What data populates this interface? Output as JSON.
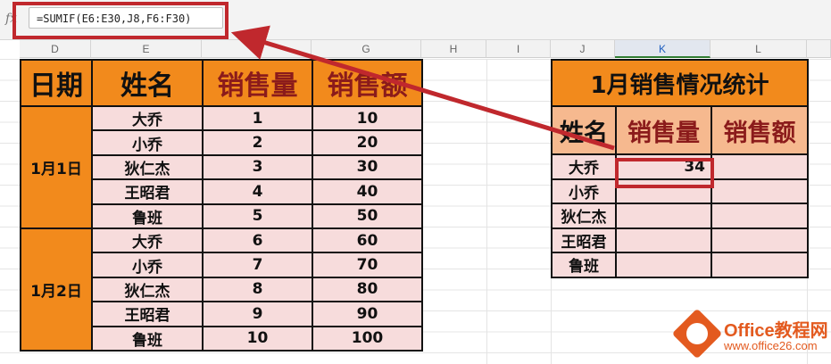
{
  "formula": "=SUMIF(E6:E30,J8,F6:F30)",
  "fx_label": "fx",
  "columns": [
    {
      "label": "D"
    },
    {
      "label": "E"
    },
    {
      "label": "F"
    },
    {
      "label": "G"
    },
    {
      "label": "H"
    },
    {
      "label": "I"
    },
    {
      "label": "J"
    },
    {
      "label": "K"
    },
    {
      "label": "L"
    }
  ],
  "left_table": {
    "headers": [
      "日期",
      "姓名",
      "销售量",
      "销售额"
    ],
    "groups": [
      {
        "date": "1月1日",
        "rows": [
          {
            "name": "大乔",
            "qty": "1",
            "amt": "10"
          },
          {
            "name": "小乔",
            "qty": "2",
            "amt": "20"
          },
          {
            "name": "狄仁杰",
            "qty": "3",
            "amt": "30"
          },
          {
            "name": "王昭君",
            "qty": "4",
            "amt": "40"
          },
          {
            "name": "鲁班",
            "qty": "5",
            "amt": "50"
          }
        ]
      },
      {
        "date": "1月2日",
        "rows": [
          {
            "name": "大乔",
            "qty": "6",
            "amt": "60"
          },
          {
            "name": "小乔",
            "qty": "7",
            "amt": "70"
          },
          {
            "name": "狄仁杰",
            "qty": "8",
            "amt": "80"
          },
          {
            "name": "王昭君",
            "qty": "9",
            "amt": "90"
          },
          {
            "name": "鲁班",
            "qty": "10",
            "amt": "100"
          }
        ]
      }
    ]
  },
  "right_table": {
    "title": "1月销售情况统计",
    "headers": [
      "姓名",
      "销售量",
      "销售额"
    ],
    "rows": [
      {
        "name": "大乔",
        "qty": "34",
        "amt": ""
      },
      {
        "name": "小乔",
        "qty": "",
        "amt": ""
      },
      {
        "name": "狄仁杰",
        "qty": "",
        "amt": ""
      },
      {
        "name": "王昭君",
        "qty": "",
        "amt": ""
      },
      {
        "name": "鲁班",
        "qty": "",
        "amt": ""
      }
    ]
  },
  "logo": {
    "name": "Office教程网",
    "url": "www.office26.com"
  },
  "colors": {
    "accent_orange": "#f28a1c",
    "highlight_red": "#c0282d",
    "cell_pink": "#f7dcdc"
  }
}
